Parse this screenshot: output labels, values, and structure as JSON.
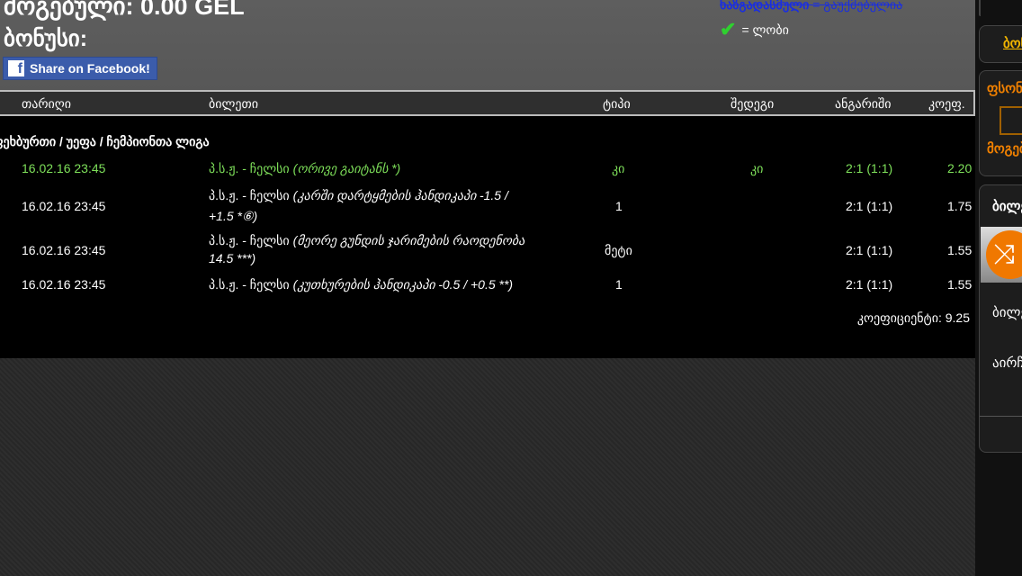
{
  "header": {
    "winnings": "მოგებული: 0.00 GEL",
    "bonus": "ბონუსი:",
    "share_facebook": "Share on Facebook!",
    "legend_strike": "ხაზგადასმული",
    "legend_strike_meaning": " = გაუქმებულია",
    "legend_check": "= ლობი"
  },
  "table": {
    "columns": [
      "თარიღი",
      "ბილეთი",
      "ტიპი",
      "შედეგი",
      "ანგარიში",
      "კოეფ."
    ],
    "league": "ფეხბურთი / უეფა / ჩემპიონთა ლიგა",
    "rows": [
      {
        "date": "16.02.16 23:45",
        "match": "პ.ს.ჟ. - ჩელსი",
        "bet": "(ორივე გაიტანს *)",
        "bet2": "",
        "type": "კი",
        "result": "კი",
        "score": "2:1 (1:1)",
        "odds": "2.20",
        "won": true
      },
      {
        "date": "16.02.16 23:45",
        "match": "პ.ს.ჟ. - ჩელსი",
        "bet": "(კარში დარტყმების ჰანდიკაპი -1.5 /",
        "bet2": "+1.5  *⑥)",
        "type": "1",
        "result": "",
        "score": "2:1 (1:1)",
        "odds": "1.75",
        "won": false
      },
      {
        "date": "16.02.16 23:45",
        "match": "პ.ს.ჟ. - ჩელსი",
        "bet": "(მეორე გუნდის ჯარიმების რაოდენობა",
        "bet2": "14.5 ***)",
        "type": "მეტი",
        "result": "",
        "score": "2:1 (1:1)",
        "odds": "1.55",
        "won": false
      },
      {
        "date": "16.02.16 23:45",
        "match": "პ.ს.ჟ. - ჩელსი",
        "bet": "(კუთხურების ჰანდიკაპი -0.5 / +0.5 **)",
        "bet2": "",
        "type": "1",
        "result": "",
        "score": "2:1 (1:1)",
        "odds": "1.55",
        "won": false
      }
    ],
    "total": "კოეფიციენტი: 9.25"
  },
  "sidebar": {
    "bonus": "ბონუსი",
    "fsports": "ფსონი",
    "win": "მოგება",
    "tickets": "ბილეთები",
    "tickets2": "ბილეთი",
    "choose": "აირჩიე"
  }
}
